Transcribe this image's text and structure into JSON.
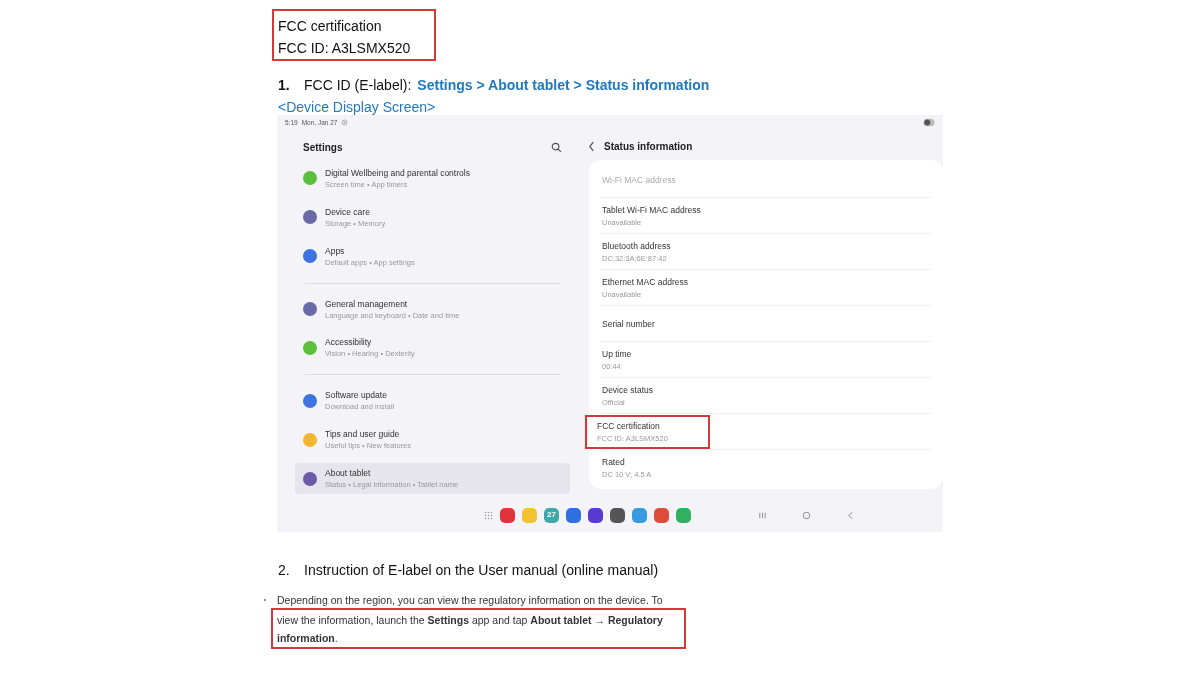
{
  "label_box": {
    "lines": [
      "FCC certification",
      "FCC ID: A3LSMX520"
    ]
  },
  "step_1": {
    "number": "1.",
    "text": "FCC ID (E-label):",
    "path": "Settings > About tablet > Status information"
  },
  "caption": "<Device Display Screen>",
  "tablet": {
    "status_bar": {
      "time": "5:19",
      "date": "Mon, Jan 27"
    },
    "settings": {
      "title": "Settings",
      "groups": [
        [
          {
            "title": "Digital Wellbeing and parental controls",
            "subtitle": "Screen time • App timers",
            "color": "#5cc03c",
            "selected": false
          },
          {
            "title": "Device care",
            "subtitle": "Storage • Memory",
            "color": "#6a6aa8",
            "selected": false
          },
          {
            "title": "Apps",
            "subtitle": "Default apps • App settings",
            "color": "#3e74e0",
            "selected": false
          }
        ],
        [
          {
            "title": "General management",
            "subtitle": "Language and keyboard • Date and time",
            "color": "#6a6aa8",
            "selected": false
          },
          {
            "title": "Accessibility",
            "subtitle": "Vision • Hearing • Dexterity",
            "color": "#5cc03c",
            "selected": false
          }
        ],
        [
          {
            "title": "Software update",
            "subtitle": "Download and install",
            "color": "#3e74e0",
            "selected": false
          },
          {
            "title": "Tips and user guide",
            "subtitle": "Useful tips • New features",
            "color": "#f2b632",
            "selected": false
          },
          {
            "title": "About tablet",
            "subtitle": "Status • Legal information • Tablet name",
            "color": "#6a5aa8",
            "selected": true
          }
        ]
      ]
    },
    "status_information": {
      "title": "Status information",
      "items": [
        {
          "title": "Wi-Fi MAC address",
          "disabled": true,
          "highlighted": false
        },
        {
          "title": "Tablet Wi-Fi MAC address",
          "subtitle": "Unavailable",
          "disabled": false,
          "highlighted": false
        },
        {
          "title": "Bluetooth address",
          "subtitle": "DC:32:3A:6E:87:42",
          "disabled": false,
          "highlighted": false
        },
        {
          "title": "Ethernet MAC address",
          "subtitle": "Unavailable",
          "disabled": false,
          "highlighted": false
        },
        {
          "title": "Serial number",
          "disabled": false,
          "highlighted": false
        },
        {
          "title": "Up time",
          "subtitle": "00:44",
          "disabled": false,
          "highlighted": false
        },
        {
          "title": "Device status",
          "subtitle": "Official",
          "disabled": false,
          "highlighted": false
        },
        {
          "title": "FCC certification",
          "subtitle": "FCC ID: A3LSMX520",
          "disabled": false,
          "highlighted": true
        },
        {
          "title": "Rated",
          "subtitle": "DC 10 V; 4.5 A",
          "disabled": false,
          "highlighted": false
        }
      ]
    },
    "dock": {
      "apps": [
        {
          "color": "#e0343a"
        },
        {
          "color": "#f2c232"
        },
        {
          "color": "#3fa8a8",
          "label": "27"
        },
        {
          "color": "#2f6fe0"
        },
        {
          "color": "#5a3ad0"
        },
        {
          "color": "#555555"
        },
        {
          "color": "#3a9ae0"
        },
        {
          "color": "#e04a3a"
        },
        {
          "color": "#30b060"
        }
      ]
    }
  },
  "step_2": {
    "number": "2.",
    "text": "Instruction of E-label on the User manual (online manual)"
  },
  "manual_text": {
    "before_frame": "Depending on the region, you can view the regulatory information on the device. To",
    "framed": "view the information, launch the **Settings** app and tap **About tablet** → **Regulatory information**."
  }
}
